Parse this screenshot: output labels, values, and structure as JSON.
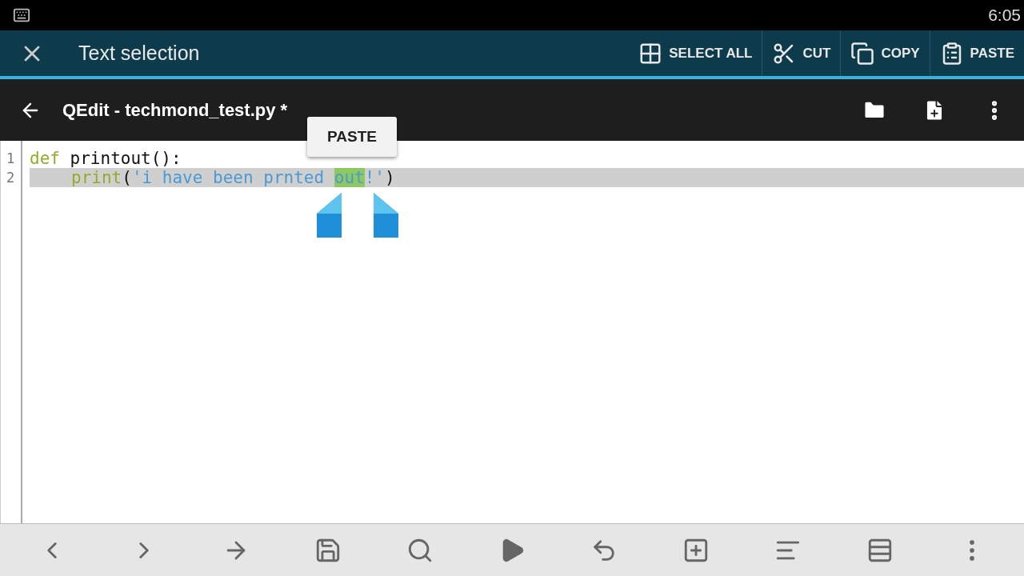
{
  "status_bar": {
    "time": "6:05"
  },
  "action_mode": {
    "title": "Text selection",
    "actions": [
      {
        "kind": "select_all",
        "label": "SELECT ALL"
      },
      {
        "kind": "cut",
        "label": "CUT"
      },
      {
        "kind": "copy",
        "label": "COPY"
      },
      {
        "kind": "paste",
        "label": "PASTE"
      }
    ]
  },
  "app_bar": {
    "title": "QEdit - techmond_test.py *",
    "actions": [
      {
        "kind": "folder"
      },
      {
        "kind": "new_file"
      },
      {
        "kind": "more"
      }
    ]
  },
  "editor": {
    "popup": "PASTE",
    "lines": [
      {
        "number": "1",
        "current": false,
        "tokens": [
          {
            "text": "def",
            "kind": "keyword",
            "selected": false
          },
          {
            "text": " printout():",
            "kind": "plain",
            "selected": false
          }
        ],
        "children": [
          {
            "number": "2",
            "current": true,
            "tokens": [
              {
                "text": "print",
                "kind": "keyword",
                "selected": false
              },
              {
                "text": "(",
                "kind": "plain",
                "selected": false
              },
              {
                "text": "'i have been prnted ",
                "kind": "string",
                "selected": false
              },
              {
                "text": "out",
                "kind": "string",
                "selected": true
              },
              {
                "text": "!'",
                "kind": "string",
                "selected": false
              },
              {
                "text": ")",
                "kind": "plain",
                "selected": false
              }
            ]
          }
        ]
      }
    ]
  },
  "toolbar": [
    {
      "kind": "back"
    },
    {
      "kind": "forward"
    },
    {
      "kind": "goto"
    },
    {
      "kind": "save"
    },
    {
      "kind": "search"
    },
    {
      "kind": "run"
    },
    {
      "kind": "undo"
    },
    {
      "kind": "add_window"
    },
    {
      "kind": "format"
    },
    {
      "kind": "list"
    },
    {
      "kind": "more"
    }
  ]
}
